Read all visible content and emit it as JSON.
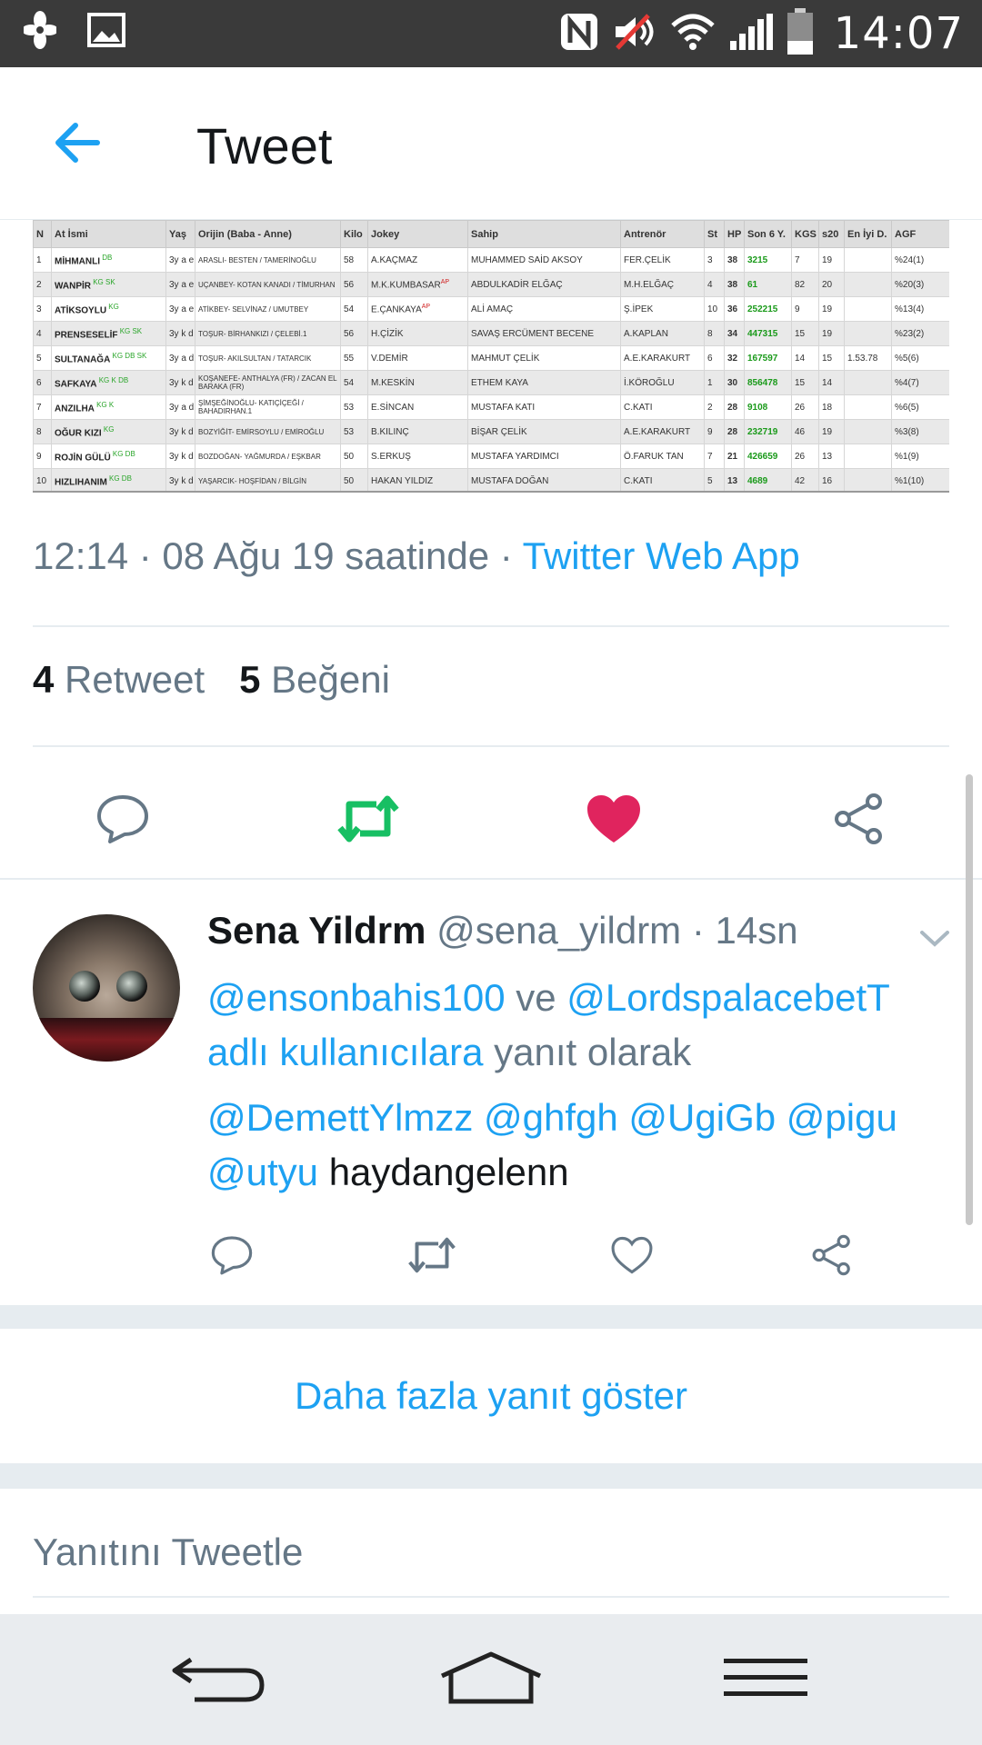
{
  "status_bar": {
    "time": "14:07",
    "icons": [
      "pinwheel-icon",
      "image-icon",
      "nfc-icon",
      "volume-muted-icon",
      "wifi-icon",
      "signal-icon",
      "battery-icon"
    ]
  },
  "app_bar": {
    "back_icon": "back-arrow-icon",
    "title": "Tweet"
  },
  "tweet_image": {
    "headers": [
      "N",
      "At İsmi",
      "Yaş",
      "Orijin (Baba - Anne)",
      "Kilo",
      "Jokey",
      "Sahip",
      "Antrenör",
      "St",
      "HP",
      "Son 6 Y.",
      "KGS",
      "s20",
      "En İyi D.",
      "AGF"
    ],
    "rows": [
      [
        "1",
        "MİHMANLI",
        "DB",
        "3y a e",
        "ARASLI- BESTEN / TAMERİNOĞLU",
        "58",
        "A.KAÇMAZ",
        "",
        "MUHAMMED SAİD AKSOY",
        "FER.ÇELİK",
        "3",
        "38",
        "3215",
        "7",
        "19",
        "",
        "%24(1)"
      ],
      [
        "2",
        "WANPİR",
        "KG SK",
        "3y a e",
        "UÇANBEY- KOTAN KANADI / TİMURHAN",
        "56",
        "M.K.KUMBASAR",
        "AP",
        "ABDULKADİR ELĞAÇ",
        "M.H.ELĞAÇ",
        "4",
        "38",
        "61",
        "82",
        "20",
        "",
        "%20(3)"
      ],
      [
        "3",
        "ATİKSOYLU",
        "KG",
        "3y a e",
        "ATİKBEY- SELVİNAZ / UMUTBEY",
        "54",
        "E.ÇANKAYA",
        "AP",
        "ALİ AMAÇ",
        "Ş.İPEK",
        "10",
        "36",
        "252215",
        "9",
        "19",
        "",
        "%13(4)"
      ],
      [
        "4",
        "PRENSESELİF",
        "KG SK",
        "3y k d",
        "TOŞUR- BİRHANKIZI / ÇELEBİ.1",
        "56",
        "H.ÇİZİK",
        "",
        "SAVAŞ ERCÜMENT BECENE",
        "A.KAPLAN",
        "8",
        "34",
        "447315",
        "15",
        "19",
        "",
        "%23(2)"
      ],
      [
        "5",
        "SULTANAĞA",
        "KG DB SK",
        "3y a d",
        "TOŞUR- AKILSULTAN / TATARCIK",
        "55",
        "V.DEMİR",
        "",
        "MAHMUT ÇELİK",
        "A.E.KARAKURT",
        "6",
        "32",
        "167597",
        "14",
        "15",
        "1.53.78",
        "%5(6)"
      ],
      [
        "6",
        "SAFKAYA",
        "KG K DB",
        "3y k d",
        "KOŞANEFE- ANTHALYA (FR) / ZACAN EL BARAKA (FR)",
        "54",
        "M.KESKİN",
        "",
        "ETHEM KAYA",
        "İ.KÖROĞLU",
        "1",
        "30",
        "856478",
        "15",
        "14",
        "",
        "%4(7)"
      ],
      [
        "7",
        "ANZILHA",
        "KG K",
        "3y a d",
        "ŞİMŞEĞİNOĞLU- KATIÇİÇEĞİ / BAHADIRHAN.1",
        "53",
        "E.SİNCAN",
        "",
        "MUSTAFA KATI",
        "C.KATI",
        "2",
        "28",
        "9108",
        "26",
        "18",
        "",
        "%6(5)"
      ],
      [
        "8",
        "OĞUR KIZI",
        "KG",
        "3y k d",
        "BOZYİĞİT- EMİRSOYLU / EMİROĞLU",
        "53",
        "B.KILINÇ",
        "",
        "BİŞAR ÇELİK",
        "A.E.KARAKURT",
        "9",
        "28",
        "232719",
        "46",
        "19",
        "",
        "%3(8)"
      ],
      [
        "9",
        "ROJİN GÜLÜ",
        "KG DB",
        "3y k d",
        "BOZDOĞAN- YAĞMURDA / EŞKBAR",
        "50",
        "S.ERKUŞ",
        "",
        "MUSTAFA YARDIMCI",
        "Ö.FARUK TAN",
        "7",
        "21",
        "426659",
        "26",
        "13",
        "",
        "%1(9)"
      ],
      [
        "10",
        "HIZLIHANIM",
        "KG DB",
        "3y k d",
        "YAŞARCIK- HOŞFİDAN / BİLGİN",
        "50",
        "HAKAN YILDIZ",
        "",
        "MUSTAFA DOĞAN",
        "C.KATI",
        "5",
        "13",
        "4689",
        "42",
        "16",
        "",
        "%1(10)"
      ]
    ]
  },
  "tweet_meta": {
    "timestamp": "12:14 · 08 Ağu 19 saatinde · ",
    "via": "Twitter Web App"
  },
  "counts": {
    "retweet_count": "4",
    "retweet_label": "Retweet",
    "like_count": "5",
    "like_label": "Beğeni"
  },
  "actions": {
    "icons": [
      "reply-icon",
      "retweet-icon",
      "heart-filled-icon",
      "share-icon"
    ],
    "retweet_color": "#17bf63",
    "like_color": "#e0245e"
  },
  "reply": {
    "name": "Sena Yildrm",
    "handle": " @sena_yildrm · 14sn",
    "reply_to_mention1": "@ensonbahis100",
    "reply_to_ve": " ve ",
    "reply_to_mention2": "@LordspalacebetT",
    "reply_to_suffix1": "adlı kullanıcılara",
    "reply_to_suffix2": " yanıt olarak",
    "body_mentions": "@DemettYlmzz @ghfgh @UgiGb @pigu",
    "body_mention_last": "@utyu",
    "body_text": " haydangelenn"
  },
  "more_replies": "Daha fazla yanıt göster",
  "compose": {
    "placeholder": "Yanıtını Tweetle"
  },
  "colors": {
    "accent": "#1da1f2",
    "secondary_text": "#657786",
    "primary_text": "#14171a"
  }
}
